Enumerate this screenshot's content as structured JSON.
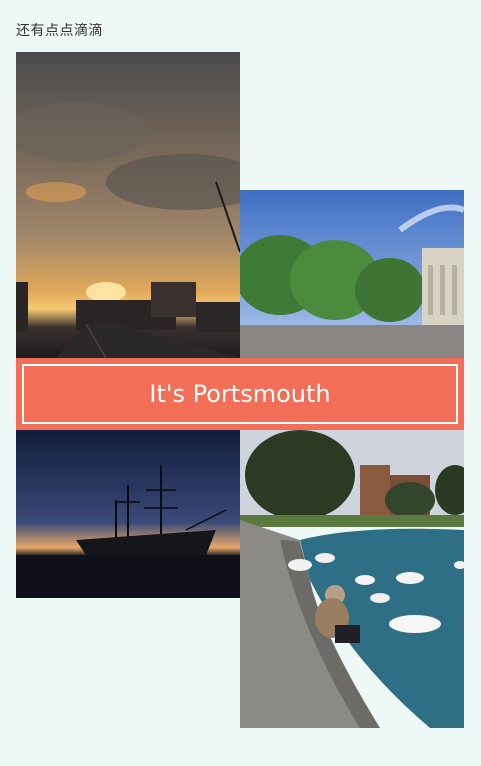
{
  "header": {
    "caption": "还有点点滴滴"
  },
  "banner": {
    "title": "It's Portsmouth"
  },
  "colors": {
    "background": "#eef8f6",
    "banner": "#f36e56",
    "banner_border": "#ffffff"
  },
  "photos": [
    {
      "name": "sunset-street-photo"
    },
    {
      "name": "square-trees-photo"
    },
    {
      "name": "tall-ship-dusk-photo"
    },
    {
      "name": "swans-lake-photo"
    }
  ]
}
